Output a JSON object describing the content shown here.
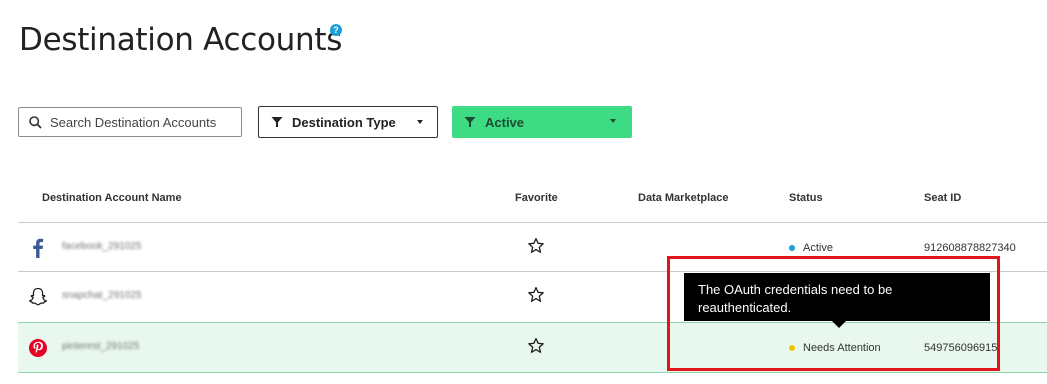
{
  "page": {
    "title": "Destination Accounts",
    "help_icon": "question-circle-icon"
  },
  "toolbar": {
    "search_placeholder": "Search Destination Accounts",
    "type_filter": {
      "label": "Destination Type",
      "icon": "funnel-icon"
    },
    "status_filter": {
      "label": "Active",
      "icon": "funnel-icon",
      "color": "#3ddc84"
    }
  },
  "table": {
    "headers": {
      "name": "Destination Account Name",
      "favorite": "Favorite",
      "marketplace": "Data Marketplace",
      "status": "Status",
      "seat": "Seat ID"
    },
    "rows": [
      {
        "platform": "facebook",
        "name": "facebook_291025",
        "favorite": false,
        "status": "Active",
        "status_color": "#1a9fd9",
        "seat_id": "912608878827340"
      },
      {
        "platform": "snapchat",
        "name": "snapchat_291025",
        "favorite": false,
        "status": "",
        "status_color": "",
        "seat_id": ""
      },
      {
        "platform": "pinterest",
        "name": "pinterest_291025",
        "favorite": false,
        "status": "Needs Attention",
        "status_color": "#f2c400",
        "seat_id": "549756096915"
      }
    ]
  },
  "tooltip": {
    "text": "The OAuth credentials need to be reauthenticated."
  },
  "colors": {
    "accent_green": "#3ddc84",
    "row_highlight": "#e9f8ef",
    "annotation_red": "#e0141a"
  }
}
